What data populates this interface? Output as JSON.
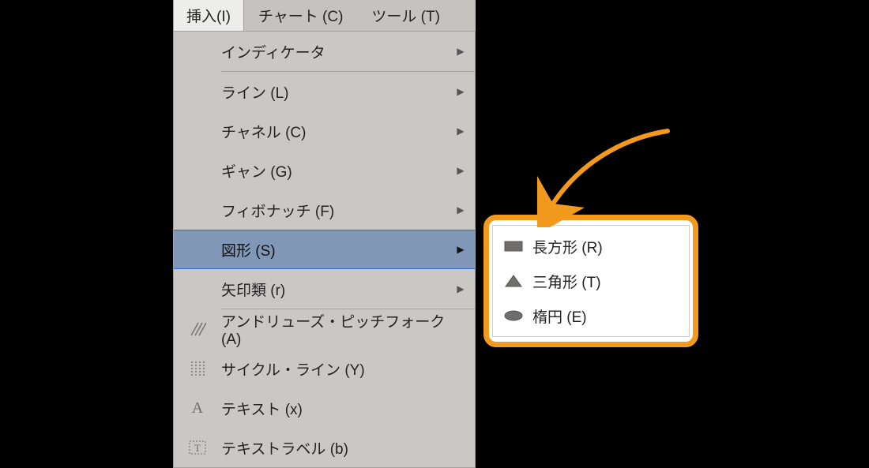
{
  "menubar": {
    "items": [
      {
        "label": "挿入(I)",
        "active": true
      },
      {
        "label": "チャート (C)",
        "active": false
      },
      {
        "label": "ツール (T)",
        "active": false
      }
    ]
  },
  "menu": {
    "groups": [
      [
        {
          "key": "indicator",
          "label": "インディケータ",
          "hasSubmenu": true,
          "icon": ""
        }
      ],
      [
        {
          "key": "line",
          "label": "ライン (L)",
          "hasSubmenu": true,
          "icon": ""
        },
        {
          "key": "channel",
          "label": "チャネル (C)",
          "hasSubmenu": true,
          "icon": ""
        },
        {
          "key": "gann",
          "label": "ギャン (G)",
          "hasSubmenu": true,
          "icon": ""
        },
        {
          "key": "fibonacci",
          "label": "フィボナッチ (F)",
          "hasSubmenu": true,
          "icon": ""
        },
        {
          "key": "shapes",
          "label": "図形 (S)",
          "hasSubmenu": true,
          "icon": "",
          "highlight": true
        },
        {
          "key": "arrows",
          "label": "矢印類 (r)",
          "hasSubmenu": true,
          "icon": ""
        }
      ],
      [
        {
          "key": "pitchfork",
          "label": "アンドリューズ・ピッチフォーク (A)",
          "hasSubmenu": false,
          "icon": "hatch"
        },
        {
          "key": "cycle",
          "label": "サイクル・ライン (Y)",
          "hasSubmenu": false,
          "icon": "vlines"
        },
        {
          "key": "text",
          "label": "テキスト (x)",
          "hasSubmenu": false,
          "icon": "A"
        },
        {
          "key": "textlabel",
          "label": "テキストラベル (b)",
          "hasSubmenu": false,
          "icon": "Tbox"
        }
      ]
    ]
  },
  "submenu": {
    "items": [
      {
        "key": "rectangle",
        "label": "長方形 (R)",
        "icon": "rect"
      },
      {
        "key": "triangle",
        "label": "三角形 (T)",
        "icon": "tri"
      },
      {
        "key": "ellipse",
        "label": "楕円 (E)",
        "icon": "ellipse"
      }
    ]
  },
  "colors": {
    "highlight": "#f29a1d",
    "menuSelBg": "#8197b7",
    "menuSelBorder": "#2e6ec5"
  }
}
